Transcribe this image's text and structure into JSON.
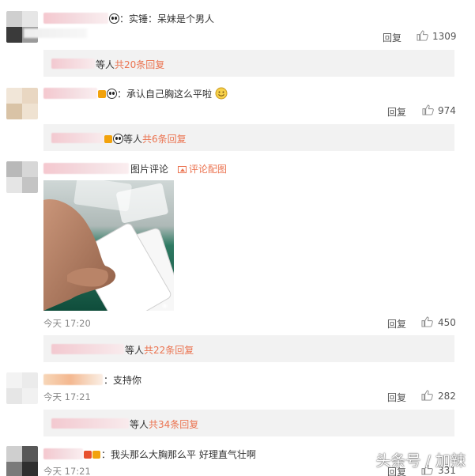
{
  "comments": [
    {
      "text": "：实锤：呆妹是个男人",
      "time": "",
      "reply": "回复",
      "likes": "1309",
      "sub": {
        "suffix": "等人",
        "link": "共20条回复"
      }
    },
    {
      "text": "：承认自己胸这么平啦",
      "time": "",
      "reply": "回复",
      "likes": "974",
      "sub": {
        "suffix": "等人",
        "link": "共6条回复"
      }
    },
    {
      "text": "图片评论",
      "image_link": "评论配图",
      "time": "今天 17:20",
      "reply": "回复",
      "likes": "450",
      "sub": {
        "suffix": "等人",
        "link": "共22条回复"
      }
    },
    {
      "text": "：支持你",
      "time": "今天 17:21",
      "reply": "回复",
      "likes": "282",
      "sub": {
        "suffix": "等人",
        "link": "共34条回复"
      }
    },
    {
      "text": "：我头那么大胸那么平 好理直气壮啊",
      "time": "今天 17:21",
      "reply": "回复",
      "likes": "331"
    }
  ],
  "watermark": "头条号 / 加辣",
  "colors": {
    "link": "#eb7350",
    "subbar_bg": "#f2f2f2"
  },
  "icons": [
    "panda-emoji",
    "thumb-up-icon",
    "vip-badge-icon",
    "image-icon",
    "smile-emoji"
  ]
}
